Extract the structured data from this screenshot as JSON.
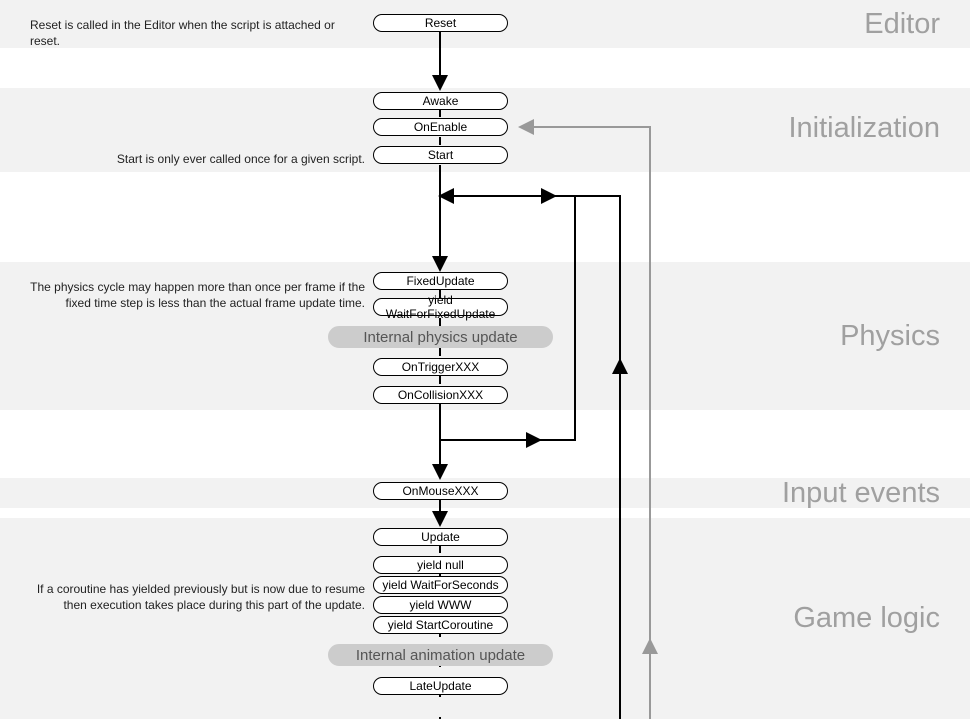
{
  "sections": {
    "editor": "Editor",
    "init": "Initialization",
    "physics": "Physics",
    "input": "Input events",
    "game": "Game logic"
  },
  "notes": {
    "reset": "Reset is called in the Editor when the script is attached or reset.",
    "start": "Start is only ever called once for a given script.",
    "physics": "The physics cycle may happen more than once per frame if the fixed time step is less than the actual frame update time.",
    "coroutine": "If a coroutine has yielded previously but is now due to resume then execution takes place during this part of the update."
  },
  "nodes": {
    "reset": "Reset",
    "awake": "Awake",
    "onenable": "OnEnable",
    "start": "Start",
    "fixedupdate": "FixedUpdate",
    "yieldfixed": "yield WaitForFixedUpdate",
    "internalphys": "Internal physics update",
    "ontrigger": "OnTriggerXXX",
    "oncollision": "OnCollisionXXX",
    "onmouse": "OnMouseXXX",
    "update": "Update",
    "yieldnull": "yield null",
    "yieldsecs": "yield WaitForSeconds",
    "yieldwww": "yield WWW",
    "yieldstart": "yield StartCoroutine",
    "internalanim": "Internal animation update",
    "lateupdate": "LateUpdate"
  }
}
